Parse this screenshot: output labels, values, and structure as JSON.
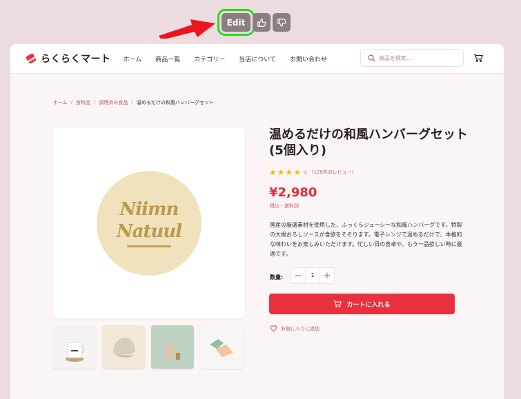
{
  "toolbar": {
    "edit_label": "Edit",
    "like_icon": "thumbs-up-icon",
    "dislike_icon": "thumbs-down-icon"
  },
  "header": {
    "logo_text": "らくらくマート",
    "menu": [
      "ホーム",
      "商品一覧",
      "カテゴリー",
      "当店について",
      "お問い合わせ"
    ],
    "search_placeholder": "商品を検索...",
    "cart_icon": "cart-icon"
  },
  "breadcrumb": {
    "items": [
      "ホーム",
      "食料品",
      "調理済み食品"
    ],
    "current": "温めるだけの和風ハンバーグセット"
  },
  "product": {
    "image_text_line1": "Niimn",
    "image_text_line2": "Natuul",
    "title": "温めるだけの和風ハンバーグセット (5個入り)",
    "rating": 4,
    "rating_max": 5,
    "review_text": "(120件のレビュー)",
    "price": "¥2,980",
    "tax_note": "税込・送料別",
    "description": "国産の厳選素材を使用した、ふっくらジューシーな和風ハンバーグです。特製の大根おろしソースが食欲をそそります。電子レンジで温めるだけで、本格的な味わいをお楽しみいただけます。忙しい日の食卓や、もう一品欲しい時に最適です。",
    "quantity_label": "数量:",
    "quantity": "1",
    "add_to_cart": "カートに入れる",
    "favorite": "お気に入りに追加"
  },
  "colors": {
    "accent": "#e8303e",
    "link": "#c05a66",
    "highlight": "#22dd22"
  }
}
